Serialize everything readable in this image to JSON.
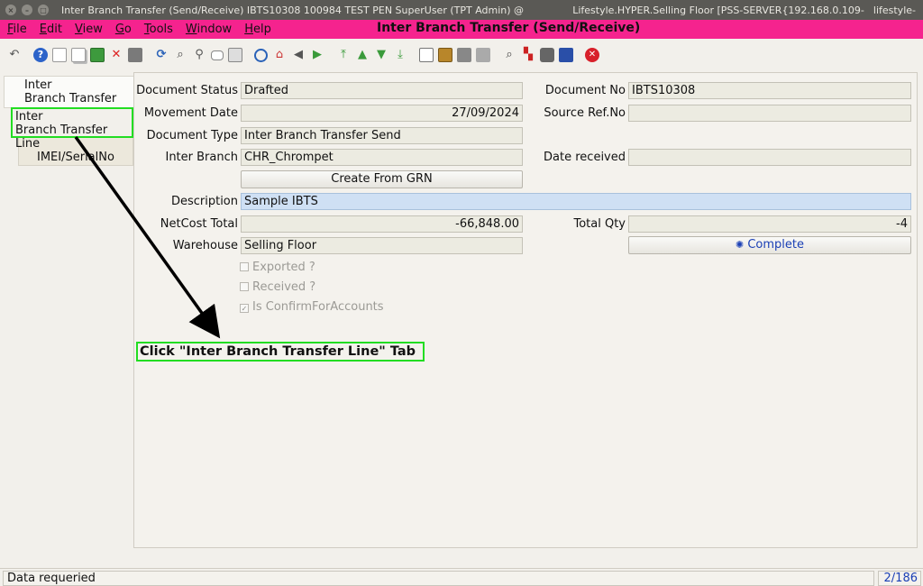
{
  "window": {
    "title": "Inter Branch Transfer (Send/Receive)  IBTS10308  100984  TEST PEN  SuperUser (TPT Admin) @",
    "title_mid": "Lifestyle.HYPER.Selling Floor [PSS-SERVER{192.168.0.109-",
    "title_right": "lifestyle-"
  },
  "menu": {
    "items": [
      {
        "key": "F",
        "rest": "ile"
      },
      {
        "key": "E",
        "rest": "dit"
      },
      {
        "key": "V",
        "rest": "iew"
      },
      {
        "key": "G",
        "rest": "o"
      },
      {
        "key": "T",
        "rest": "ools"
      },
      {
        "key": "W",
        "rest": "indow"
      },
      {
        "key": "H",
        "rest": "elp"
      }
    ],
    "app_title": "Inter Branch Transfer (Send/Receive)"
  },
  "tabs": {
    "tab1_line1": "Inter",
    "tab1_line2": "Branch Transfer",
    "tab2_line1": "Inter",
    "tab2_line2": "Branch Transfer Line",
    "tab3": "IMEI/SerialNo"
  },
  "form": {
    "document_status_label": "Document Status",
    "document_status": "Drafted",
    "document_no_label": "Document No",
    "document_no": "IBTS10308",
    "movement_date_label": "Movement Date",
    "movement_date": "27/09/2024",
    "source_ref_label": "Source Ref.No",
    "source_ref": "",
    "document_type_label": "Document Type",
    "document_type": "Inter Branch Transfer Send",
    "inter_branch_label": "Inter Branch",
    "inter_branch": "CHR_Chrompet",
    "date_received_label": "Date received",
    "date_received": "",
    "create_from_grn": "Create From GRN",
    "description_label": "Description",
    "description": "Sample IBTS",
    "netcost_total_label": "NetCost Total",
    "netcost_total": "-66,848.00",
    "total_qty_label": "Total Qty",
    "total_qty": "-4",
    "warehouse_label": "Warehouse",
    "warehouse": "Selling Floor",
    "complete_button": "Complete",
    "exported": "Exported ?",
    "received": "Received ?",
    "is_confirm": "Is ConfirmForAccounts"
  },
  "annotation": {
    "instruction": "Click \"Inter Branch Transfer Line\" Tab"
  },
  "status": {
    "message": "Data requeried",
    "page": "2/186"
  },
  "colors": {
    "menu_bar": "#f5238e",
    "highlight": "#22dd22",
    "description_field": "#cfe0f4"
  }
}
